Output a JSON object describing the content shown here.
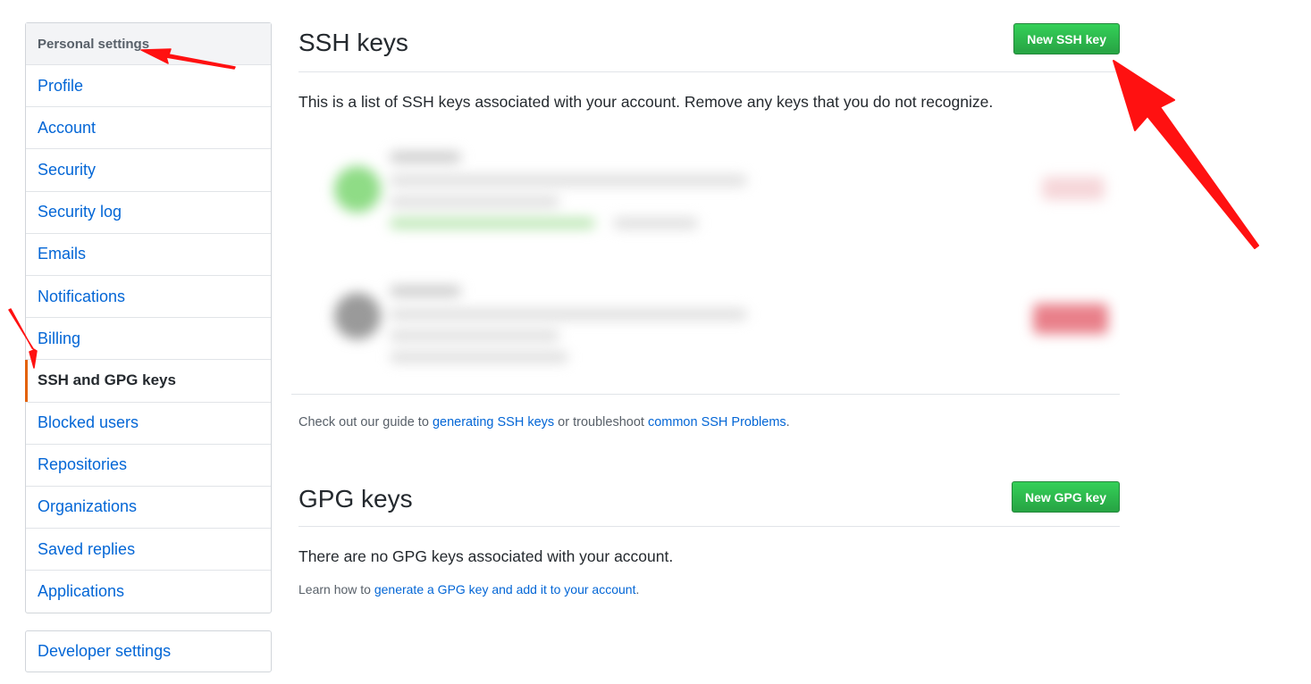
{
  "sidebar": {
    "header": "Personal settings",
    "items": [
      {
        "label": "Profile"
      },
      {
        "label": "Account"
      },
      {
        "label": "Security"
      },
      {
        "label": "Security log"
      },
      {
        "label": "Emails"
      },
      {
        "label": "Notifications"
      },
      {
        "label": "Billing"
      },
      {
        "label": "SSH and GPG keys",
        "selected": true
      },
      {
        "label": "Blocked users"
      },
      {
        "label": "Repositories"
      },
      {
        "label": "Organizations"
      },
      {
        "label": "Saved replies"
      },
      {
        "label": "Applications"
      }
    ],
    "developer_settings": "Developer settings"
  },
  "ssh": {
    "title": "SSH keys",
    "new_button": "New SSH key",
    "description": "This is a list of SSH keys associated with your account. Remove any keys that you do not recognize.",
    "guide_prefix": "Check out our guide to ",
    "guide_link": "generating SSH keys",
    "guide_middle": " or troubleshoot ",
    "troubleshoot_link": "common SSH Problems",
    "guide_suffix": "."
  },
  "gpg": {
    "title": "GPG keys",
    "new_button": "New GPG key",
    "empty_text": "There are no GPG keys associated with your account.",
    "learn_prefix": "Learn how to ",
    "learn_link": "generate a GPG key and add it to your account",
    "learn_suffix": "."
  },
  "colors": {
    "primary_green": "#28a745",
    "link_blue": "#0366d6",
    "selected_accent": "#e36209",
    "annotation_red": "#ff1111"
  }
}
